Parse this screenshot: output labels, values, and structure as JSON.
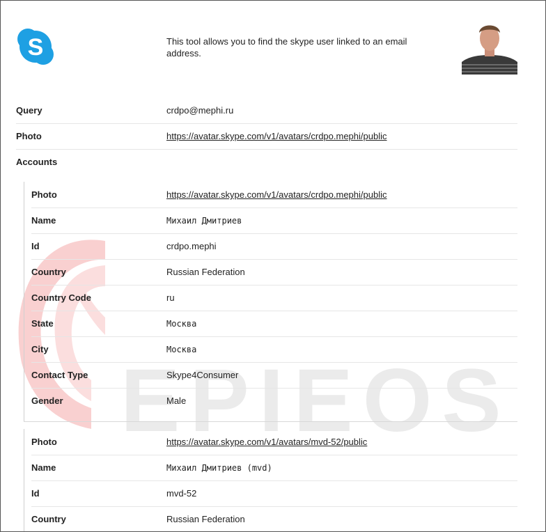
{
  "header": {
    "description": "This tool allows you to find the skype user linked to an email address.",
    "logo_icon": "skype-logo-icon",
    "avatar_alt": "profile-photo"
  },
  "main": {
    "query_label": "Query",
    "query_value": "crdpo@mephi.ru",
    "photo_label": "Photo",
    "photo_value": "https://avatar.skype.com/v1/avatars/crdpo.mephi/public",
    "accounts_label": "Accounts"
  },
  "accounts": [
    {
      "photo_label": "Photo",
      "photo_value": "https://avatar.skype.com/v1/avatars/crdpo.mephi/public",
      "name_label": "Name",
      "name_value": "Михаил Дмитриев",
      "id_label": "Id",
      "id_value": "crdpo.mephi",
      "country_label": "Country",
      "country_value": "Russian Federation",
      "country_code_label": "Country Code",
      "country_code_value": "ru",
      "state_label": "State",
      "state_value": "Москва",
      "city_label": "City",
      "city_value": "Москва",
      "contact_type_label": "Contact Type",
      "contact_type_value": "Skype4Consumer",
      "gender_label": "Gender",
      "gender_value": "Male"
    },
    {
      "photo_label": "Photo",
      "photo_value": "https://avatar.skype.com/v1/avatars/mvd-52/public",
      "name_label": "Name",
      "name_value": "Михаил Дмитриев (mvd)",
      "id_label": "Id",
      "id_value": "mvd-52",
      "country_label": "Country",
      "country_value": "Russian Federation"
    }
  ],
  "watermark": {
    "text": "EPIEOS"
  },
  "colors": {
    "skype_blue": "#1ea0e3",
    "watermark_red": "#f7c9c9",
    "watermark_grey": "#ebebeb"
  }
}
